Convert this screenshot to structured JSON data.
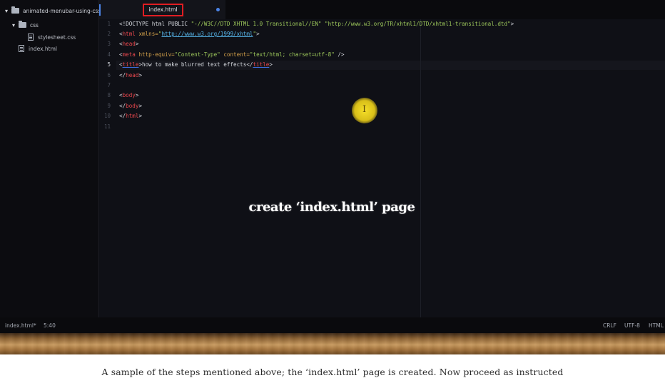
{
  "sidebar": {
    "project_folder": "animated-menubar-using-css",
    "css_folder": "css",
    "stylesheet_file": "stylesheet.css",
    "index_file": "index.html"
  },
  "tabs": [
    {
      "label": "index.html",
      "active": true,
      "modified": true
    }
  ],
  "editor": {
    "line_numbers": [
      "1",
      "2",
      "3",
      "4",
      "5",
      "6",
      "7",
      "8",
      "9",
      "10",
      "11"
    ],
    "active_line": 5,
    "lines": {
      "l1": {
        "punct1": "<!DOCTYPE html PUBLIC ",
        "str1": "\"-//W3C//DTD XHTML 1.0 Transitional//EN\"",
        "space": " ",
        "str2": "\"http://www.w3.org/TR/xhtml1/DTD/xhtml1-transitional.dtd\"",
        "punct2": ">"
      },
      "l2": {
        "open": "<",
        "tag": "html",
        "attr": " xmlns=",
        "q1": "\"",
        "url": "http://www.w3.org/1999/xhtml",
        "q2": "\"",
        "close": ">"
      },
      "l3": {
        "open": "<",
        "tag": "head",
        "close": ">"
      },
      "l4": {
        "open": "<",
        "tag": "meta",
        "attr1": " http-equiv=",
        "val1": "\"Content-Type\"",
        "attr2": " content=",
        "val2": "\"text/html; charset=utf-8\"",
        "close": " />"
      },
      "l5": {
        "open": "<",
        "tag": "title",
        "close": ">",
        "text": "how to make blurred text effects",
        "open2": "</",
        "tag2": "title",
        "close2": ">"
      },
      "l6": {
        "open": "</",
        "tag": "head",
        "close": ">"
      },
      "l8": {
        "open": "<",
        "tag": "body",
        "close": ">"
      },
      "l9": {
        "open": "</",
        "tag": "body",
        "close": ">"
      },
      "l10": {
        "open": "</",
        "tag": "html",
        "close": ">"
      }
    }
  },
  "cursor_glyph": "I",
  "overlay_caption": "create ‘index.html’ page",
  "status": {
    "file": "index.html*",
    "position": "5:40",
    "line_ending": "CRLF",
    "encoding": "UTF-8",
    "grammar": "HTML"
  },
  "figure_caption": "A sample of the steps mentioned above; the ‘index.html’ page is created. Now proceed as instructed",
  "colors": {
    "tab_highlight": "#e01d22",
    "modified_dot": "#4b84e6",
    "cursor_halo": "#f5df2a"
  }
}
